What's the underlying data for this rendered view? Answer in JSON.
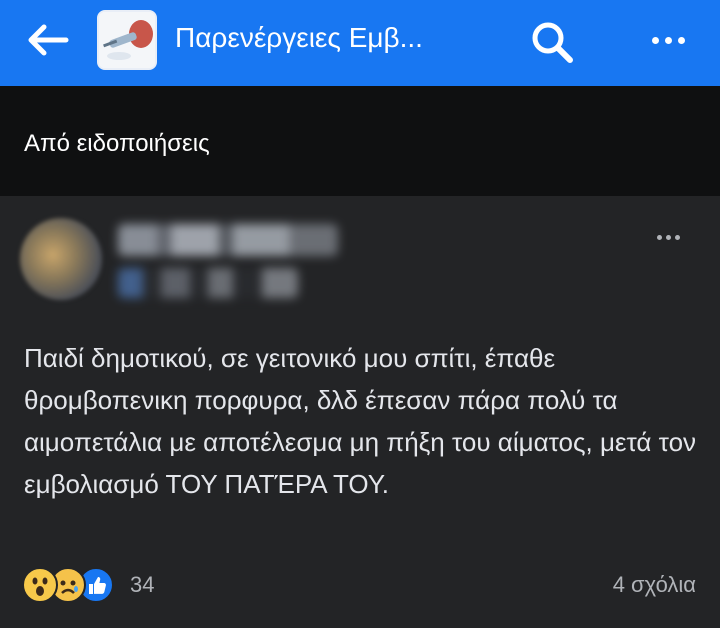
{
  "header": {
    "title": "Παρενέργειες Εμβ...",
    "back_icon": "arrow-left-icon",
    "search_icon": "search-icon",
    "more_icon": "more-horizontal-icon",
    "bar_color": "#1877f2"
  },
  "notification_banner": {
    "label": "Από ειδοποιήσεις"
  },
  "post": {
    "author_name": "",
    "timestamp": "",
    "text": "Παιδί δημοτικού, σε γειτονικό μου σπίτι, έπαθε θρομβοπενικη πορφυρα, δλδ έπεσαν πάρα πολύ τα αιμοπετάλια με αποτέλεσμα μη πήξη του αίματος, μετά τον εμβολιασμό ΤΟΥ ΠΑΤΈΡΑ ΤΟΥ.",
    "reaction_icons": [
      "wow-reaction-icon",
      "sad-reaction-icon",
      "like-reaction-icon"
    ],
    "reaction_count": "34",
    "comments_label": "4 σχόλια"
  }
}
